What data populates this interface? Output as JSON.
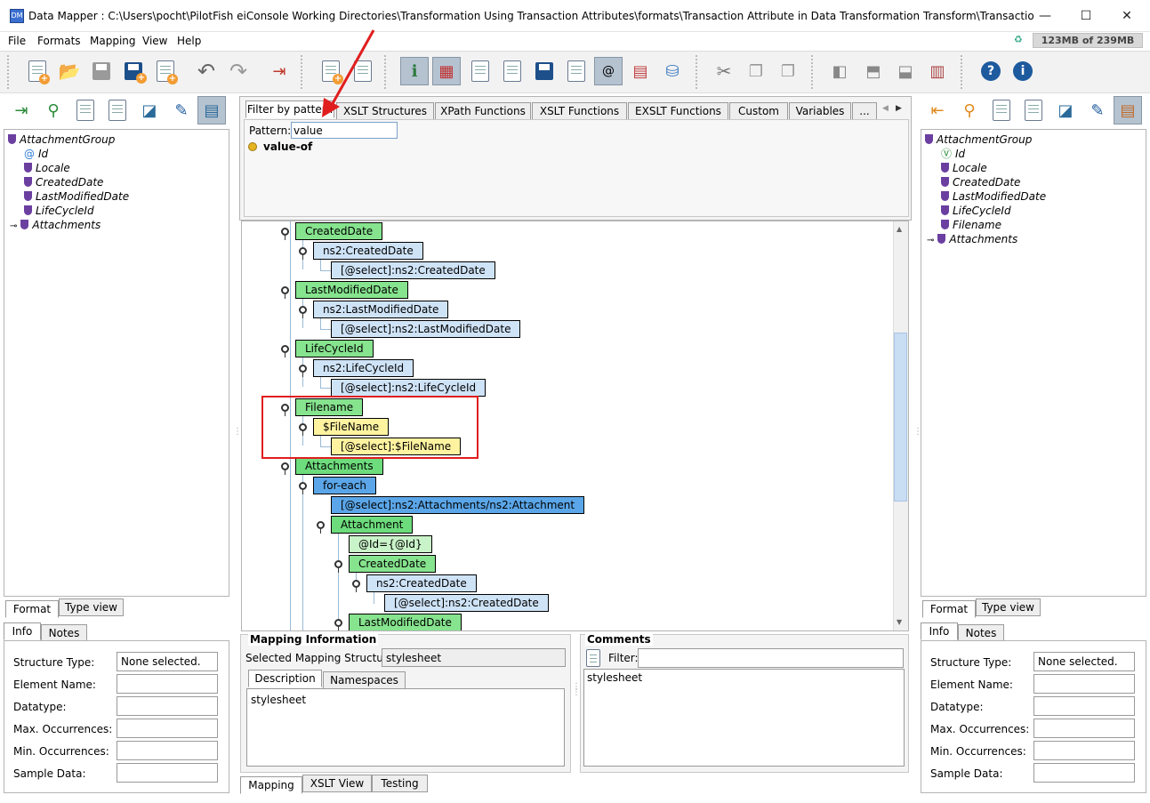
{
  "window": {
    "title": "Data Mapper : C:\\Users\\pocht\\PilotFish eiConsole Working Directories\\Transformation Using Transaction Attributes\\formats\\Transaction Attribute in Data Transformation Transform\\TransactionAttributeTransform...",
    "minimize": "—",
    "maximize": "☐",
    "close": "✕"
  },
  "menu": {
    "file": "File",
    "formats": "Formats",
    "mapping": "Mapping",
    "view": "View",
    "help": "Help",
    "memory": "123MB of 239MB"
  },
  "left_tree": {
    "root": "AttachmentGroup",
    "items": [
      "Id",
      "Locale",
      "CreatedDate",
      "LastModifiedDate",
      "LifeCycleId",
      "Attachments"
    ]
  },
  "right_tree": {
    "root": "AttachmentGroup",
    "items": [
      "Id",
      "Locale",
      "CreatedDate",
      "LastModifiedDate",
      "LifeCycleId",
      "Filename",
      "Attachments"
    ]
  },
  "palette": {
    "tabs": [
      "Filter by pattern",
      "XSLT Structures",
      "XPath Functions",
      "XSLT Functions",
      "EXSLT Functions",
      "Custom",
      "Variables",
      "..."
    ],
    "pattern_label": "Pattern:",
    "pattern_value": "value",
    "result": "value-of"
  },
  "mapping_tree": {
    "nodes": [
      "CreatedDate",
      "ns2:CreatedDate",
      "[@select]:ns2:CreatedDate",
      "LastModifiedDate",
      "ns2:LastModifiedDate",
      "[@select]:ns2:LastModifiedDate",
      "LifeCycleId",
      "ns2:LifeCycleId",
      "[@select]:ns2:LifeCycleId",
      "Filename",
      "$FileName",
      "[@select]:$FileName",
      "Attachments",
      "for-each",
      "[@select]:ns2:Attachments/ns2:Attachment",
      "Attachment",
      "@Id={@Id}",
      "CreatedDate",
      "ns2:CreatedDate",
      "[@select]:ns2:CreatedDate",
      "LastModifiedDate"
    ]
  },
  "left_bottom": {
    "view_tabs": [
      "Format",
      "Type view"
    ],
    "info_tabs": [
      "Info",
      "Notes"
    ],
    "fields": [
      {
        "label": "Structure Type:",
        "value": "None selected."
      },
      {
        "label": "Element Name:",
        "value": ""
      },
      {
        "label": "Datatype:",
        "value": ""
      },
      {
        "label": "Max. Occurrences:",
        "value": ""
      },
      {
        "label": "Min. Occurrences:",
        "value": ""
      },
      {
        "label": "Sample Data:",
        "value": ""
      }
    ]
  },
  "right_bottom": {
    "view_tabs": [
      "Format",
      "Type view"
    ],
    "info_tabs": [
      "Info",
      "Notes"
    ],
    "fields": [
      {
        "label": "Structure Type:",
        "value": "None selected."
      },
      {
        "label": "Element Name:",
        "value": ""
      },
      {
        "label": "Datatype:",
        "value": ""
      },
      {
        "label": "Max. Occurrences:",
        "value": ""
      },
      {
        "label": "Min. Occurrences:",
        "value": ""
      },
      {
        "label": "Sample Data:",
        "value": ""
      }
    ]
  },
  "mapping_info": {
    "title": "Mapping Information",
    "selected_label": "Selected Mapping Structure:",
    "selected_value": "stylesheet",
    "tabs": [
      "Description",
      "Namespaces"
    ],
    "description": "stylesheet"
  },
  "comments": {
    "title": "Comments",
    "filter_label": "Filter:",
    "filter_value": "",
    "text": "stylesheet"
  },
  "bottom_tabs": [
    "Mapping",
    "XSLT View",
    "Testing"
  ],
  "colors": {
    "highlight": "#e01e1e",
    "arrow": "#e01e1e"
  }
}
